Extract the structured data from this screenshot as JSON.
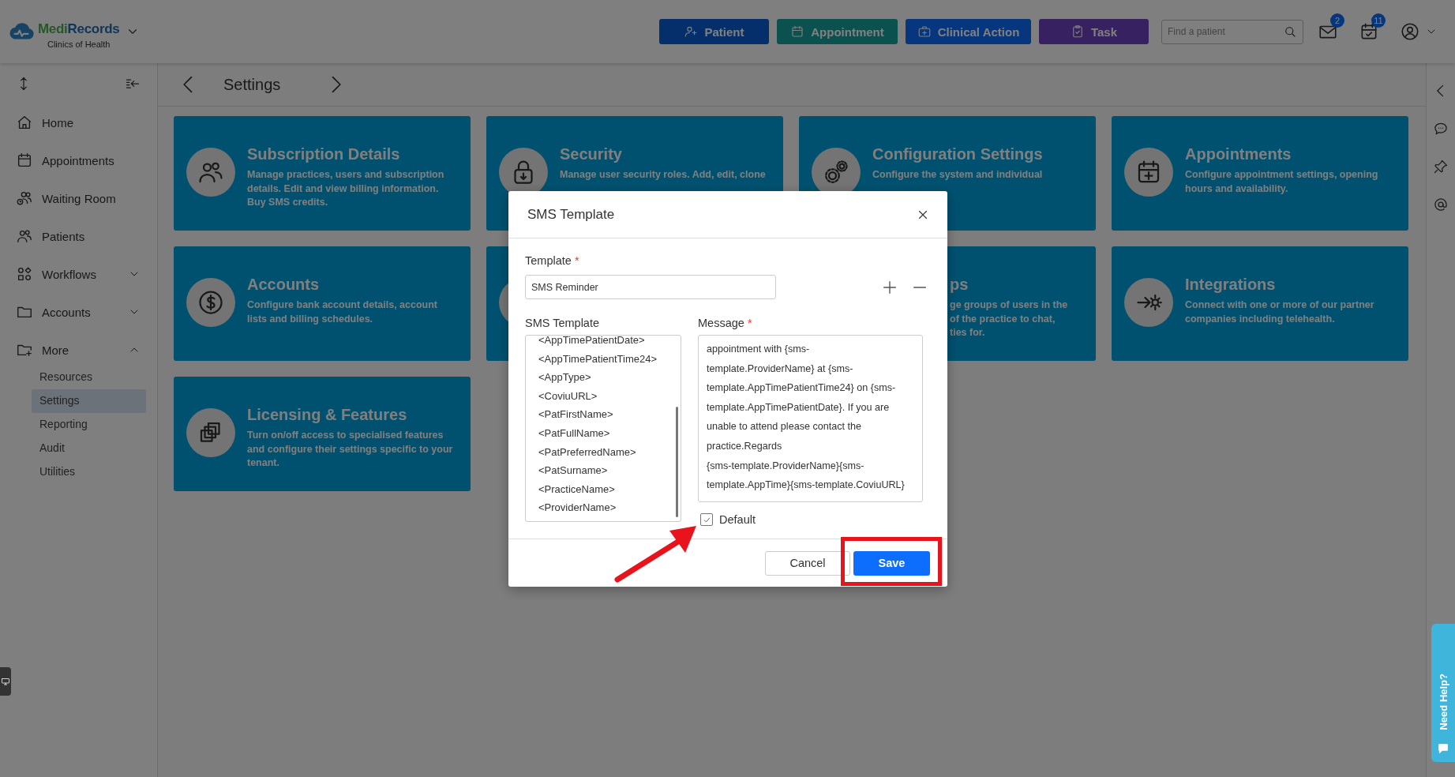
{
  "header": {
    "logo": {
      "brand_first": "Medi",
      "brand_second": "Records",
      "subtitle": "Clinics of Health"
    },
    "actions": [
      {
        "label": "Patient"
      },
      {
        "label": "Appointment"
      },
      {
        "label": "Clinical Action"
      },
      {
        "label": "Task"
      }
    ],
    "search": {
      "placeholder": "Find a patient"
    },
    "notifications": [
      {
        "kind": "mail",
        "badge": "2"
      },
      {
        "kind": "tasks",
        "badge": "11"
      }
    ]
  },
  "sidebar": {
    "items": [
      {
        "label": "Home"
      },
      {
        "label": "Appointments"
      },
      {
        "label": "Waiting Room"
      },
      {
        "label": "Patients"
      },
      {
        "label": "Workflows",
        "expanded": false
      },
      {
        "label": "Accounts",
        "expanded": false
      },
      {
        "label": "More",
        "expanded": true,
        "children": [
          {
            "label": "Resources",
            "selected": false
          },
          {
            "label": "Settings",
            "selected": true
          },
          {
            "label": "Reporting",
            "selected": false
          },
          {
            "label": "Audit",
            "selected": false
          },
          {
            "label": "Utilities",
            "selected": false
          }
        ]
      }
    ]
  },
  "page": {
    "title": "Settings"
  },
  "cards": [
    {
      "kind": "full",
      "title": "Subscription Details",
      "description": "Manage practices, users and subscription details. Edit and view billing information. Buy SMS credits."
    },
    {
      "kind": "full",
      "title": "Security",
      "description": "Manage user security roles. Add, edit, clone"
    },
    {
      "kind": "full",
      "title": "Configuration Settings",
      "description": "Configure the system and individual"
    },
    {
      "kind": "full",
      "title": "Appointments",
      "description": "Configure appointment settings, opening hours and availability."
    },
    {
      "kind": "full",
      "title": "Accounts",
      "description": "Configure bank account details, account lists and billing schedules."
    },
    {
      "kind": "covered"
    },
    {
      "kind": "clipped",
      "title": "ps",
      "description": "ge groups of users in the\nof the practice to chat,\nties for."
    },
    {
      "kind": "full",
      "title": "Integrations",
      "description": "Connect with one or more of our partner companies including telehealth."
    },
    {
      "kind": "full",
      "title": "Licensing & Features",
      "description": "Turn on/off access to specialised features and configure their settings specific to your tenant."
    }
  ],
  "modal": {
    "title": "SMS Template",
    "template_label": {
      "text": "Template",
      "required_mark": "*"
    },
    "template_value": "SMS Reminder",
    "list_label": {
      "text": "SMS Template"
    },
    "variables": [
      "<AppTimePatientDate>",
      "<AppTimePatientTime24>",
      "<AppType>",
      "<CoviuURL>",
      "<PatFirstName>",
      "<PatFullName>",
      "<PatPreferredName>",
      "<PatSurname>",
      "<PracticeName>",
      "<ProviderName>"
    ],
    "message_label": {
      "text": "Message",
      "required_mark": "*"
    },
    "message": "appointment with {sms-template.ProviderName} at {sms-template.AppTimePatientTime24} on {sms-template.AppTimePatientDate}. If you are unable to attend please contact the practice.Regards\n{sms-template.ProviderName}{sms-template.AppTime}{sms-template.CoviuURL}",
    "default": {
      "label": "Default",
      "checked": true
    },
    "buttons": [
      {
        "label": "Cancel",
        "kind": "secondary"
      },
      {
        "label": "Save",
        "kind": "primary"
      }
    ]
  },
  "help": {
    "label": "Need Help?"
  }
}
